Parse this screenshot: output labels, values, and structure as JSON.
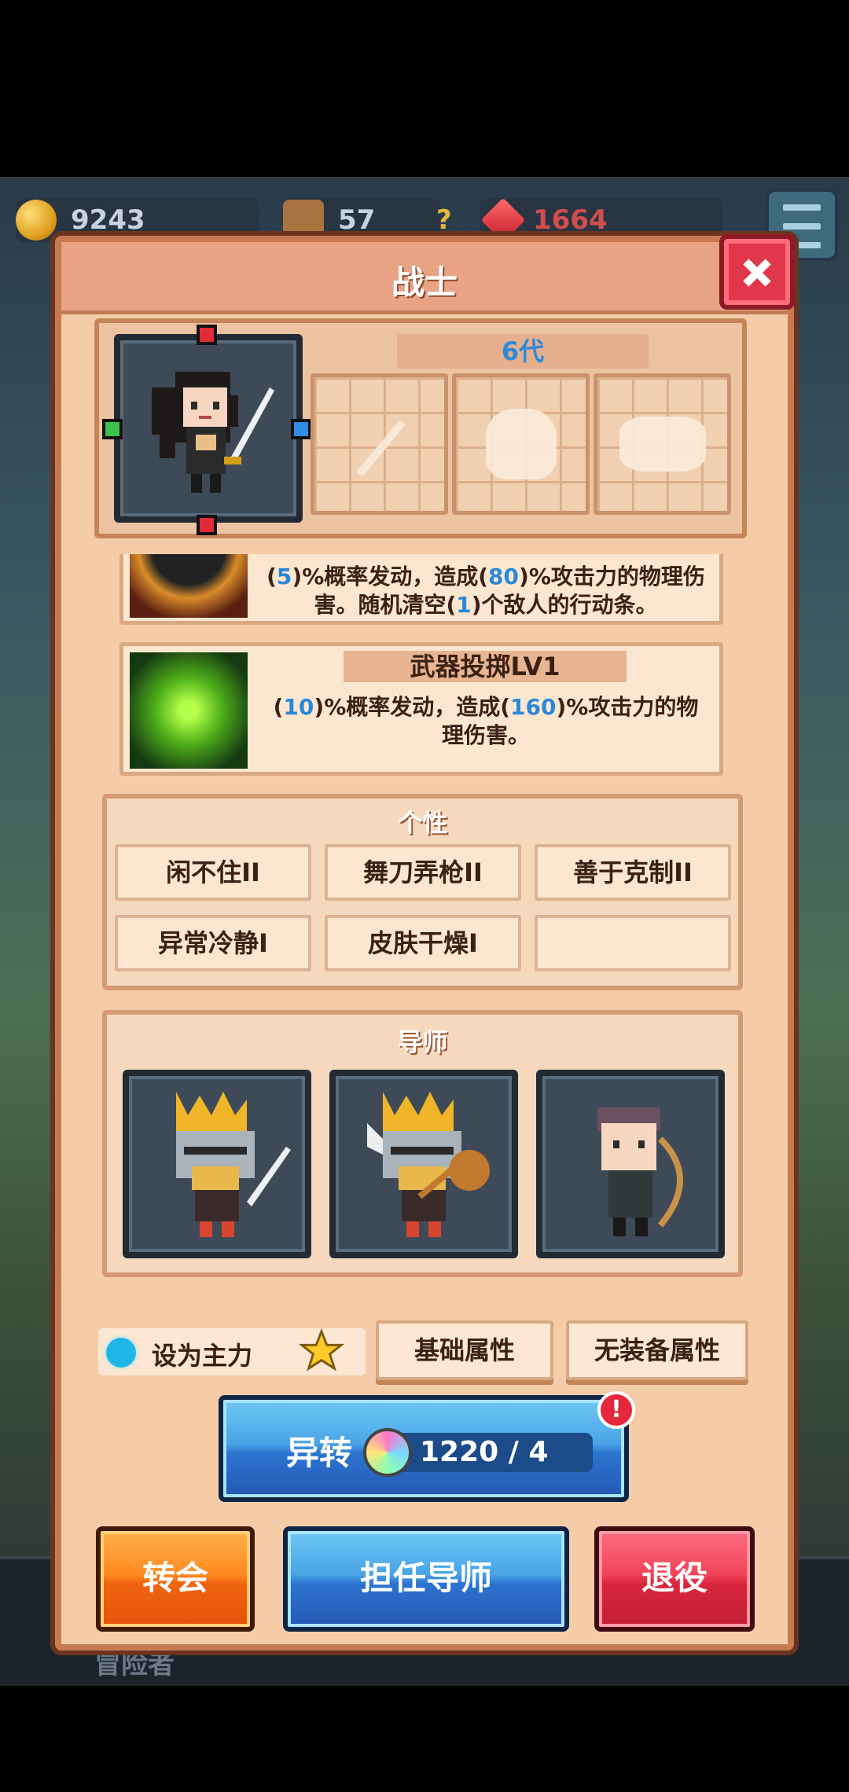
{
  "resources": {
    "coins": "9243",
    "tools": "57",
    "unknown": "?",
    "gems": "1664"
  },
  "bottom_nav_label": "冒险者",
  "panel": {
    "title": "战士",
    "generation": "6代"
  },
  "skills": [
    {
      "name": "",
      "desc_parts": [
        "(",
        "5",
        ")%概率发动，造成(",
        "80",
        ")%攻击力的物理伤害。随机清空(",
        "1",
        ")个敌人的行动条。"
      ]
    },
    {
      "name": "武器投掷LV1",
      "desc_parts": [
        "(",
        "10",
        ")%概率发动，造成(",
        "160",
        ")%攻击力的物理伤害。"
      ]
    }
  ],
  "traits": {
    "title": "个性",
    "items": [
      "闲不住II",
      "舞刀弄枪II",
      "善于克制II",
      "异常冷静I",
      "皮肤干燥I",
      ""
    ]
  },
  "mentor": {
    "title": "导师"
  },
  "controls": {
    "set_main_label": "设为主力",
    "base_attr_label": "基础属性",
    "no_equip_attr_label": "无装备属性",
    "transform_label": "异转",
    "transform_cost": "1220 / 4",
    "alert": "!",
    "transfer_label": "转会",
    "mentor_label": "担任导师",
    "retire_label": "退役"
  },
  "colors": {
    "panel_bg": "#f4cda8",
    "accent_blue": "#2a88d9",
    "close_red": "#e0374a"
  }
}
